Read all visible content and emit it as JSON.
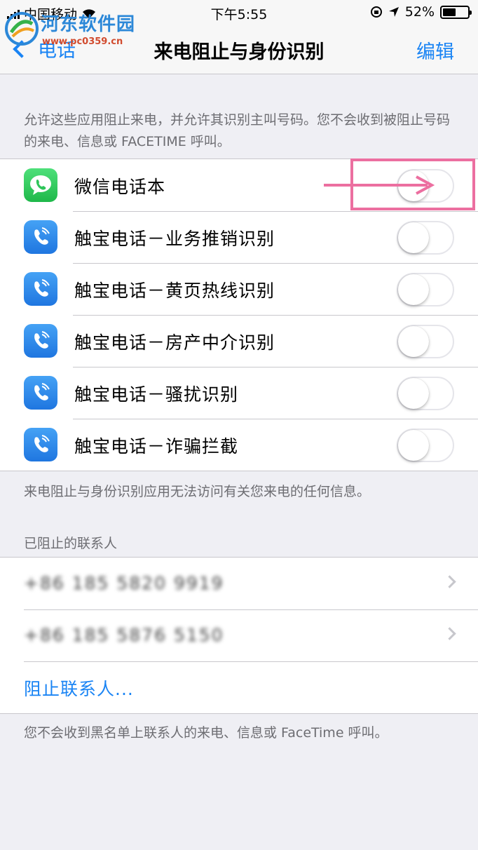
{
  "status_bar": {
    "carrier": "中国移动",
    "time": "下午5:55",
    "battery": "52%",
    "battery_level": 0.52
  },
  "watermark": {
    "title": "河东软件园",
    "url": "www.pc0359.cn"
  },
  "nav": {
    "back_label": "电话",
    "title": "来电阻止与身份识别",
    "edit_label": "编辑"
  },
  "header_note": "允许这些应用阻止来电，并允许其识别主叫号码。您不会收到被阻止号码的来电、信息或 FACETIME 呼叫。",
  "apps": [
    {
      "name": "微信电话本",
      "icon": "wechat-phonebook-icon",
      "enabled": false
    },
    {
      "name": "触宝电话－业务推销识别",
      "icon": "chubao-phone-icon",
      "enabled": false
    },
    {
      "name": "触宝电话－黄页热线识别",
      "icon": "chubao-phone-icon",
      "enabled": false
    },
    {
      "name": "触宝电话－房产中介识别",
      "icon": "chubao-phone-icon",
      "enabled": false
    },
    {
      "name": "触宝电话－骚扰识别",
      "icon": "chubao-phone-icon",
      "enabled": false
    },
    {
      "name": "触宝电话－诈骗拦截",
      "icon": "chubao-phone-icon",
      "enabled": false
    }
  ],
  "apps_footer": "来电阻止与身份识别应用无法访问有关您来电的任何信息。",
  "blocked_section_title": "已阻止的联系人",
  "blocked_contacts": [
    {
      "number": "+86 185 5820 9919"
    },
    {
      "number": "+86 185 5876 5150"
    }
  ],
  "block_contact_label": "阻止联系人...",
  "blocked_footer": "您不会收到黑名单上联系人的来电、信息或 FaceTime 呼叫。",
  "colors": {
    "accent": "#1a84f4",
    "background": "#efeff4",
    "annotation": "#ec6fa0",
    "wechat_green": "#2fc55a",
    "chubao_blue": "#2f8bea"
  }
}
